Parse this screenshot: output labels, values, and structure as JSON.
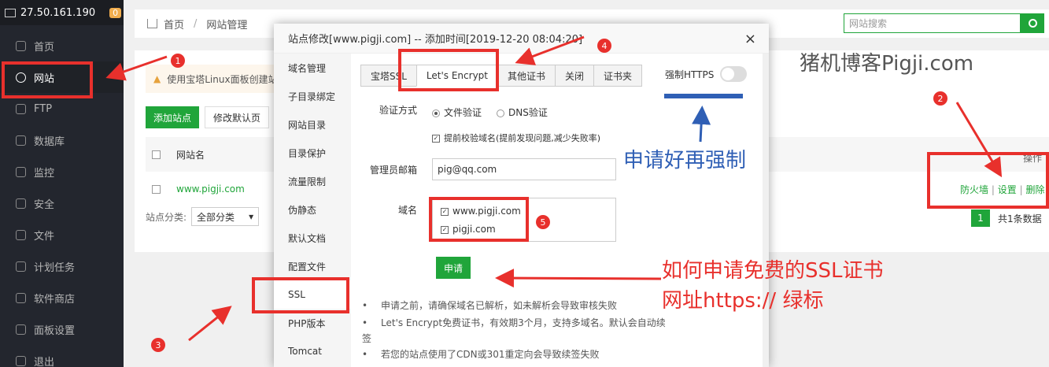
{
  "sidebar": {
    "ip": "27.50.161.190",
    "badge": "0",
    "items": [
      {
        "label": "首页",
        "icon": "home-icon"
      },
      {
        "label": "网站",
        "icon": "globe-icon"
      },
      {
        "label": "FTP",
        "icon": "ftp-icon"
      },
      {
        "label": "数据库",
        "icon": "database-icon"
      },
      {
        "label": "监控",
        "icon": "monitor-icon"
      },
      {
        "label": "安全",
        "icon": "shield-icon"
      },
      {
        "label": "文件",
        "icon": "folder-icon"
      },
      {
        "label": "计划任务",
        "icon": "calendar-icon"
      },
      {
        "label": "软件商店",
        "icon": "grid-icon"
      },
      {
        "label": "面板设置",
        "icon": "gear-icon"
      },
      {
        "label": "退出",
        "icon": "logout-icon"
      }
    ]
  },
  "header": {
    "crumb_home": "首页",
    "crumb_sep": "/",
    "crumb_current": "网站管理"
  },
  "search": {
    "placeholder": "网站搜索"
  },
  "main": {
    "notice": "使用宝塔Linux面板创建站",
    "add_site": "添加站点",
    "modify_default": "修改默认页",
    "col_name": "网站名",
    "col_op": "操作",
    "site": "www.pigji.com",
    "ops": [
      "防火墙",
      "设置",
      "删除"
    ],
    "ops_sep": "|",
    "class_label": "站点分类:",
    "class_value": "全部分类",
    "page": "1",
    "total": "共1条数据"
  },
  "modal": {
    "title": "站点修改[www.pigji.com] -- 添加时间[2019-12-20 08:04:20]",
    "close": "×",
    "nav": [
      "域名管理",
      "子目录绑定",
      "网站目录",
      "目录保护",
      "流量限制",
      "伪静态",
      "默认文档",
      "配置文件",
      "SSL",
      "PHP版本",
      "Tomcat"
    ],
    "tabs": [
      "宝塔SSL",
      "Let's Encrypt",
      "其他证书",
      "关闭",
      "证书夹"
    ],
    "force_https": "强制HTTPS",
    "verify_label": "验证方式",
    "verify_file": "文件验证",
    "verify_dns": "DNS验证",
    "precheck": "提前校验域名(提前发现问题,减少失败率)",
    "email_label": "管理员邮箱",
    "email_value": "pig@qq.com",
    "domain_label": "域名",
    "domains": [
      "www.pigji.com",
      "pigji.com"
    ],
    "apply": "申请",
    "tips": [
      "申请之前，请确保域名已解析，如未解析会导致审核失败",
      "Let's Encrypt免费证书，有效期3个月，支持多域名。默认会自动续",
      "签",
      "若您的站点使用了CDN或301重定向会导致续签失败"
    ]
  },
  "annotations": {
    "watermark": "猪机博客Pigji.com",
    "blue_note": "申请好再强制",
    "red_note_1": "如何申请免费的SSL证书",
    "red_note_2": "网址https:// 绿标",
    "numbers": [
      "1",
      "2",
      "3",
      "4",
      "5"
    ],
    "red": "#e8302c",
    "blue": "#2f5fb5"
  }
}
